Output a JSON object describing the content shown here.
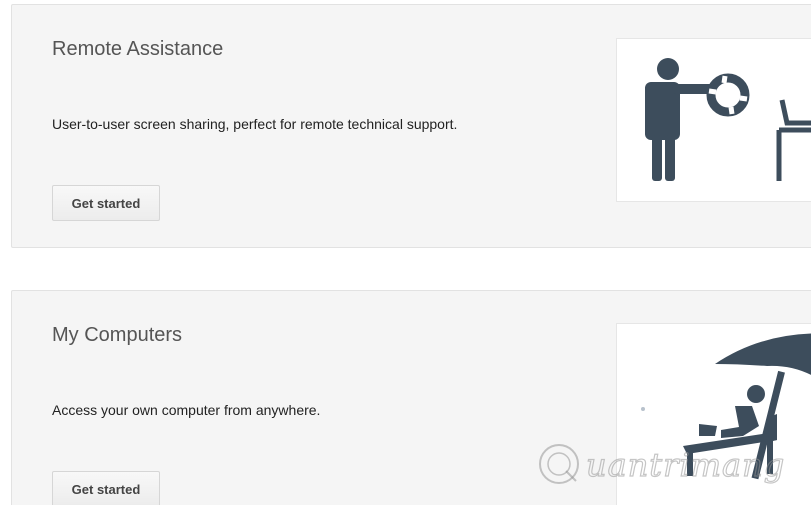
{
  "cards": {
    "remote_assistance": {
      "title": "Remote Assistance",
      "description": "User-to-user screen sharing, perfect for remote technical support.",
      "button_label": "Get started",
      "illustration_icon": "person-lifebuoy-laptop-icon"
    },
    "my_computers": {
      "title": "My Computers",
      "description": "Access your own computer from anywhere.",
      "button_label": "Get started",
      "illustration_icon": "beach-umbrella-laptop-icon"
    }
  },
  "watermark": {
    "text": "uantrimang",
    "logo_icon": "quantrimang-logo-icon"
  },
  "colors": {
    "card_bg": "#f5f5f5",
    "illustration_fg": "#3d4d5c",
    "title_text": "#555555"
  }
}
